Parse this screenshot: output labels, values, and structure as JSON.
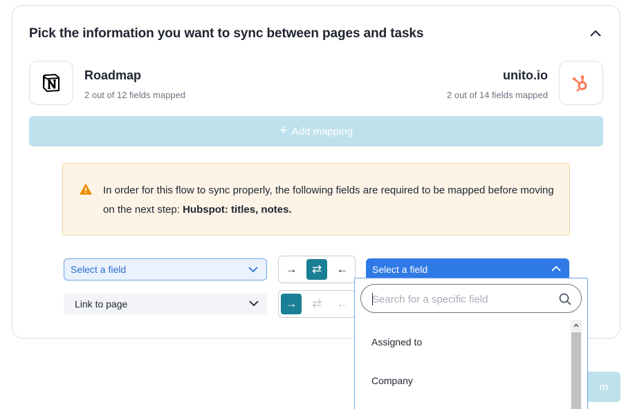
{
  "card": {
    "title": "Pick the information you want to sync between pages and tasks"
  },
  "left_app": {
    "name": "Roadmap",
    "fields_mapped": "2 out of 12 fields mapped",
    "logo_icon": "notion-logo-icon"
  },
  "right_app": {
    "name": "unito.io",
    "fields_mapped": "2 out of 14 fields mapped",
    "logo_icon": "hubspot-logo-icon",
    "logo_color": "#ff7a59"
  },
  "add_mapping": {
    "label": "Add mapping"
  },
  "warning": {
    "text": "In order for this flow to sync properly, the following fields are required to be mapped before moving on the next step: ",
    "bold": "Hubspot: titles, notes.",
    "color": "#f08c00"
  },
  "mapping_rows": [
    {
      "left": "Select a field",
      "right": "Select a field"
    },
    {
      "left": "Link to page"
    }
  ],
  "directions": {
    "to_right": "→",
    "two_way": "⇄",
    "to_left": "←"
  },
  "dropdown": {
    "search_placeholder": "Search for a specific field",
    "options": [
      "Assigned to",
      "Company"
    ]
  },
  "partial_button": {
    "label": "m"
  },
  "colors": {
    "accent": "#2f7ae5",
    "teal": "#1a7f94",
    "disabled_button": "#bfe1ec"
  }
}
